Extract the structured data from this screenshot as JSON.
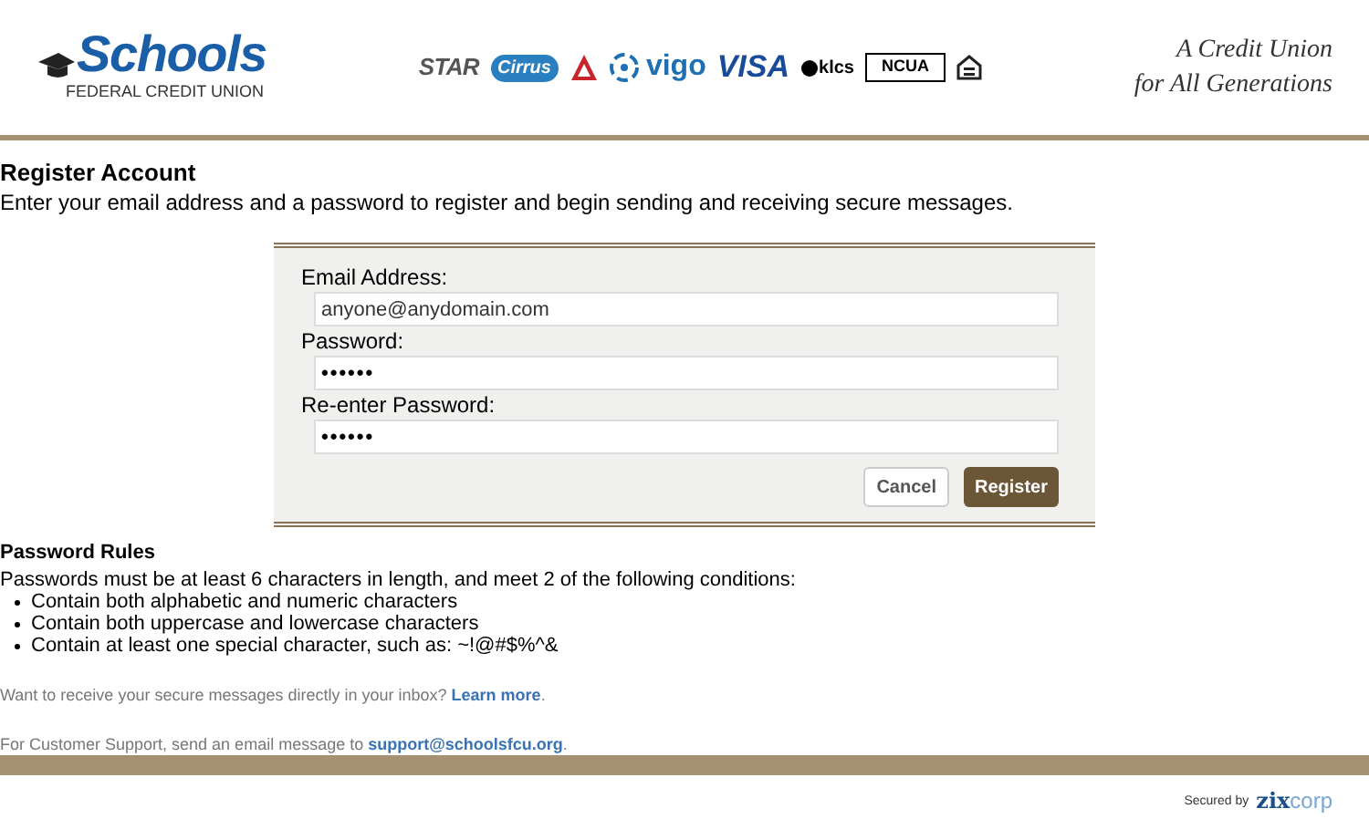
{
  "header": {
    "logo": {
      "name": "Schools",
      "subtitle": "FEDERAL CREDIT UNION"
    },
    "partner_logos": [
      {
        "kind": "star",
        "text": "STAR"
      },
      {
        "kind": "cirrus",
        "text": "Cirrus"
      },
      {
        "kind": "triangle"
      },
      {
        "kind": "vigo",
        "text": "vigo"
      },
      {
        "kind": "visa",
        "text": "VISA"
      },
      {
        "kind": "klcs",
        "text": "klcs"
      },
      {
        "kind": "ncua",
        "text": "NCUA"
      },
      {
        "kind": "housing"
      }
    ],
    "tagline": [
      "A Credit Union",
      "for All Generations"
    ]
  },
  "page": {
    "title": "Register Account",
    "intro": "Enter your email address and a password to register and begin sending and receiving secure messages."
  },
  "form": {
    "fields": [
      {
        "label": "Email Address:",
        "value": "anyone@anydomain.com",
        "kind": "text"
      },
      {
        "label": "Password:",
        "value": "••••••",
        "kind": "password"
      },
      {
        "label": "Re-enter Password:",
        "value": "••••••",
        "kind": "password"
      }
    ],
    "buttons": [
      {
        "label": "Cancel",
        "kind": "secondary"
      },
      {
        "label": "Register",
        "kind": "primary"
      }
    ]
  },
  "rules": {
    "title": "Password Rules",
    "intro": "Passwords must be at least 6 characters in length, and meet 2 of the following conditions:",
    "items": [
      "Contain both alphabetic and numeric characters",
      "Contain both uppercase and lowercase characters",
      "Contain at least one special character, such as: ~!@#$%^&"
    ]
  },
  "notes": [
    {
      "text": "Want to receive your secure messages directly in your inbox?",
      "link": "Learn more",
      "end": "."
    },
    {
      "text": "For Customer Support, send an email message to",
      "link": "support@schoolsfcu.org",
      "end": "."
    }
  ],
  "footer": {
    "secured_by": "Secured by",
    "brand": [
      "zix",
      "corp"
    ]
  }
}
